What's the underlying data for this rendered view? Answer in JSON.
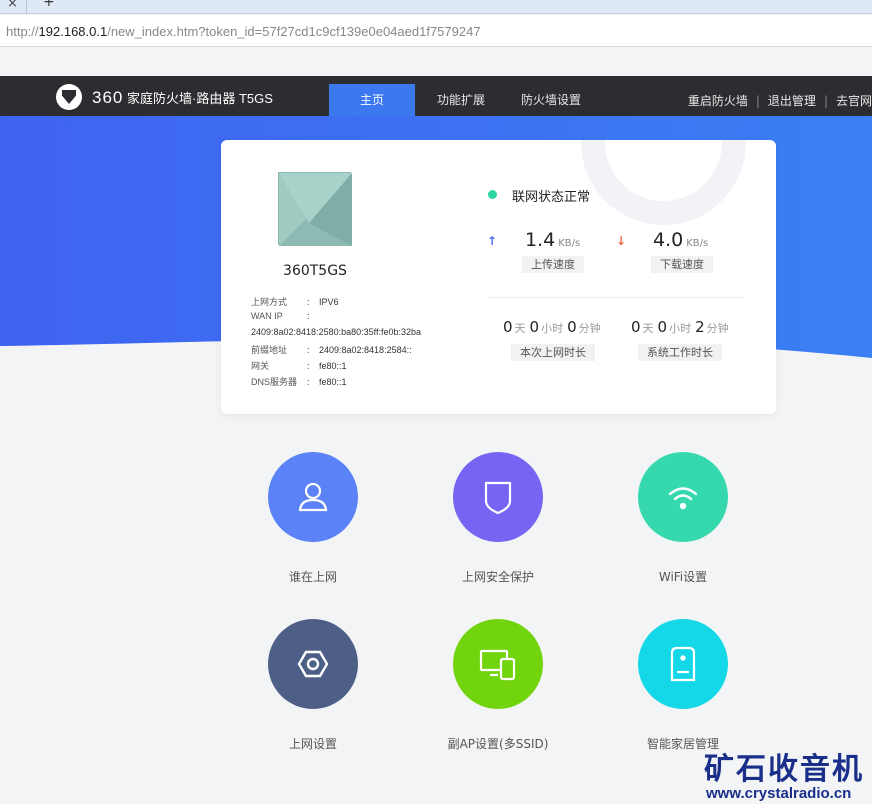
{
  "browser": {
    "tab_close": "×",
    "new_tab": "+",
    "url_scheme": "http://",
    "url_host": "192.168.0.1",
    "url_path": "/new_index.htm?token_id=57f27cd1c9cf139e0e04aed1f7579247"
  },
  "header": {
    "logo_number": "360",
    "logo_text": "家庭防火墙·路由器 T5GS",
    "tabs": [
      {
        "label": "主页",
        "active": true
      },
      {
        "label": "功能扩展",
        "active": false
      },
      {
        "label": "防火墙设置",
        "active": false
      }
    ],
    "links": [
      "重启防火墙",
      "退出管理",
      "去官网"
    ],
    "separator": "|"
  },
  "device": {
    "name": "360T5GS",
    "colon": ":",
    "info": [
      {
        "key": "上网方式",
        "value": "IPV6"
      },
      {
        "key": "WAN IP",
        "value": ""
      },
      {
        "key": "",
        "value": "2409:8a02:8418:2580:ba80:35ff:fe0b:32ba"
      },
      {
        "key": "前缀地址",
        "value": "2409:8a02:8418:2584::"
      },
      {
        "key": "网关",
        "value": "fe80::1"
      },
      {
        "key": "DNS服务器",
        "value": "fe80::1"
      }
    ]
  },
  "status": {
    "text": "联网状态正常",
    "upload_arrow": "↑",
    "upload_value": "1.4",
    "upload_unit": "KB/s",
    "upload_label": "上传速度",
    "download_arrow": "↓",
    "download_value": "4.0",
    "download_unit": "KB/s",
    "download_label": "下载速度",
    "online": {
      "days": "0",
      "hours": "0",
      "minutes": "0",
      "label": "本次上网时长"
    },
    "uptime": {
      "days": "0",
      "hours": "0",
      "minutes": "2",
      "label": "系统工作时长"
    },
    "unit_day": "天",
    "unit_hour": "小时",
    "unit_minute": "分钟"
  },
  "features": [
    {
      "label": "谁在上网",
      "icon": "user-icon",
      "color": "#5b82f6"
    },
    {
      "label": "上网安全保护",
      "icon": "shield-icon",
      "color": "#7665f2"
    },
    {
      "label": "WiFi设置",
      "icon": "wifi-icon",
      "color": "#36d9ae"
    },
    {
      "label": "上网设置",
      "icon": "hex-nut-icon",
      "color": "#4d5f87"
    },
    {
      "label": "副AP设置(多SSID)",
      "icon": "devices-icon",
      "color": "#72d40d"
    },
    {
      "label": "智能家居管理",
      "icon": "smart-home-icon",
      "color": "#14d8e8"
    }
  ],
  "watermark": {
    "title": "矿石收音机",
    "url": "www.crystalradio.cn"
  }
}
